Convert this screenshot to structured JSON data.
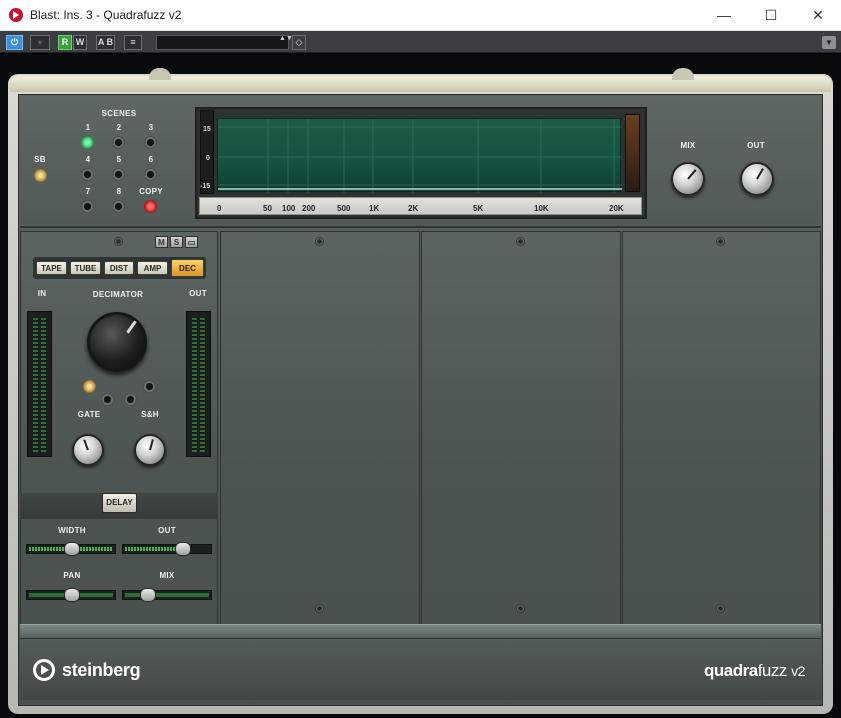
{
  "window": {
    "title": "Blast: Ins. 3 - Quadrafuzz v2",
    "min": "—",
    "max": "☐",
    "close": "✕"
  },
  "toolbar": {
    "power": "⏻",
    "bypass": "▫",
    "read": "R",
    "write": "W",
    "ab": "A B",
    "menu": "≡",
    "preset_value": "",
    "preset_arrows": "▲▼",
    "tag": "◇",
    "dropdown": "▼"
  },
  "scenes": {
    "title": "SCENES",
    "sb_label": "SB",
    "numbers": [
      "1",
      "2",
      "3",
      "4",
      "5",
      "6",
      "7",
      "8"
    ],
    "copy_label": "COPY",
    "active_scene": "1"
  },
  "display": {
    "db_labels": [
      "15",
      "0",
      "-15"
    ],
    "freq_labels": [
      "0",
      "50",
      "100",
      "200",
      "500",
      "1K",
      "2K",
      "5K",
      "10K",
      "20K"
    ]
  },
  "master": {
    "mix_label": "MIX",
    "out_label": "OUT"
  },
  "band1": {
    "solo_buttons": [
      "M",
      "S",
      "▭"
    ],
    "modes": [
      "TAPE",
      "TUBE",
      "DIST",
      "AMP",
      "DEC"
    ],
    "active_mode": "DEC",
    "in_label": "IN",
    "out_label": "OUT",
    "mode_title": "DECIMATOR",
    "gate_label": "GATE",
    "sh_label": "S&H",
    "delay_label": "DELAY",
    "width_label": "WIDTH",
    "out2_label": "OUT",
    "pan_label": "PAN",
    "mix_label": "MIX"
  },
  "footer": {
    "brand": "steinberg",
    "product_bold": "quadra",
    "product_light": "fuzz",
    "product_version": "v2"
  },
  "colors": {
    "face": "#535b58",
    "display": "#1a5543",
    "accent_active": "#d79620",
    "meter_green": "#47b44f"
  }
}
